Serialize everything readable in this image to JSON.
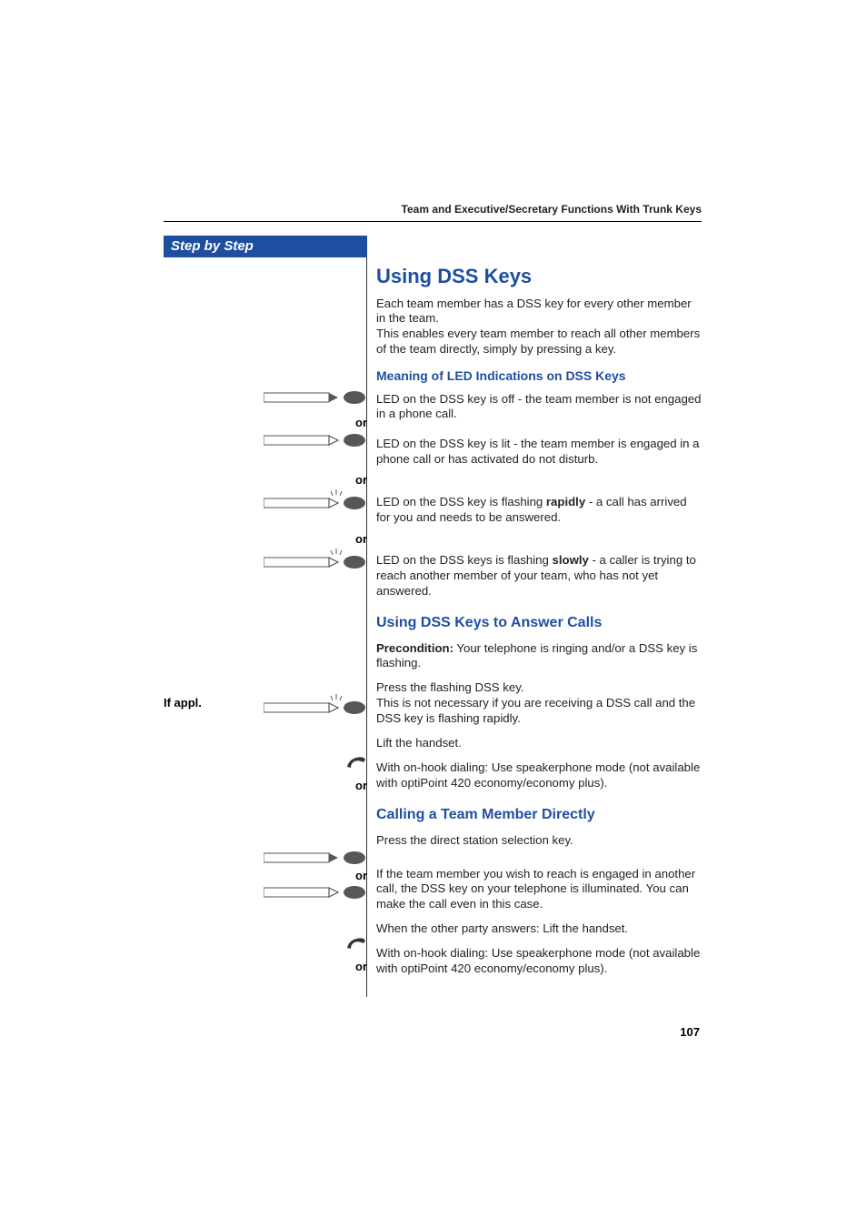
{
  "header": {
    "breadcrumb": "Team and Executive/Secretary Functions With Trunk Keys"
  },
  "sidebar": {
    "title": "Step by Step",
    "or": "or",
    "if_appl": "If appl."
  },
  "main": {
    "title": "Using DSS Keys",
    "intro": "Each team member has a DSS key for every other member in the team.\nThis enables every team member to reach all other members of the team directly, simply by pressing a key.",
    "led_heading": "Meaning of LED Indications on DSS Keys",
    "led_off": "LED on the DSS key is off - the team member is not engaged in a phone call.",
    "led_lit": "LED on the DSS key is lit - the team member is engaged in a phone call or has activated do not disturb.",
    "led_rapid_pre": "LED on the DSS key is flashing ",
    "led_rapid_bold": "rapidly",
    "led_rapid_post": " - a call has arrived for you and needs to be answered.",
    "led_slow_pre": "LED on the DSS keys is flashing ",
    "led_slow_bold": "slowly",
    "led_slow_post": " - a caller is trying to reach another member of your team, who has not yet answered.",
    "answer_heading": "Using DSS Keys to Answer Calls",
    "precond_label": "Precondition:",
    "precond_text": " Your telephone is ringing and/or a DSS key is flashing.",
    "press_flashing": "Press the flashing DSS key.\nThis is not necessary if you are receiving a DSS call and the DSS key is flashing rapidly.",
    "lift_handset": "Lift the handset.",
    "onhook": "With on-hook dialing: Use speakerphone mode (not available with optiPoint 420 economy/economy plus).",
    "calling_heading": "Calling a Team Member Directly",
    "press_dss": "Press the direct station selection key.",
    "engaged": "If the team member you wish to reach is engaged in another call, the DSS key on your telephone is illuminated. You can make the call even in this case.",
    "other_answers": "When the other party answers: Lift the handset.",
    "onhook2": "With on-hook dialing: Use speakerphone mode (not available with optiPoint 420 economy/economy plus)."
  },
  "page_number": "107"
}
